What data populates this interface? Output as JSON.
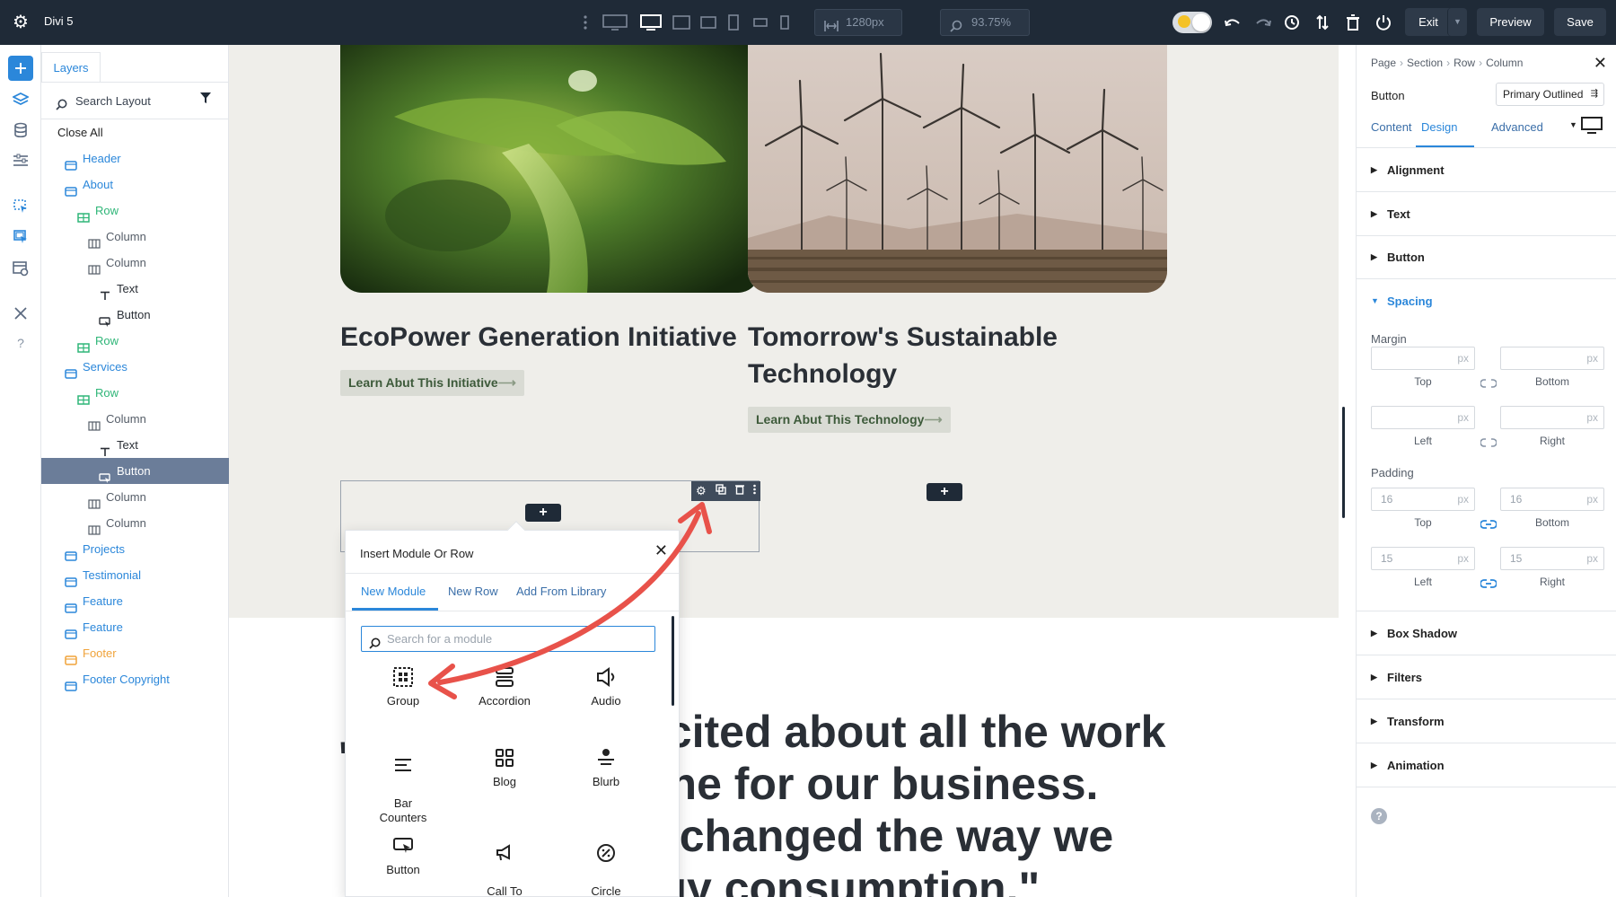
{
  "app": {
    "title": "Divi 5"
  },
  "toolbar": {
    "width_value": "1280px",
    "zoom_value": "93.75%",
    "exit_label": "Exit",
    "preview_label": "Preview",
    "save_label": "Save"
  },
  "layers": {
    "tab_label": "Layers",
    "search_placeholder": "Search Layout",
    "close_all": "Close All",
    "items": [
      {
        "label": "Header",
        "kind": "section"
      },
      {
        "label": "About",
        "kind": "section"
      },
      {
        "label": "Row",
        "kind": "row"
      },
      {
        "label": "Column",
        "kind": "column"
      },
      {
        "label": "Column",
        "kind": "column"
      },
      {
        "label": "Text",
        "kind": "text"
      },
      {
        "label": "Button",
        "kind": "button"
      },
      {
        "label": "Row",
        "kind": "row"
      },
      {
        "label": "Services",
        "kind": "section"
      },
      {
        "label": "Row",
        "kind": "row"
      },
      {
        "label": "Column",
        "kind": "column"
      },
      {
        "label": "Text",
        "kind": "text"
      },
      {
        "label": "Button",
        "kind": "button",
        "selected": true
      },
      {
        "label": "Column",
        "kind": "column"
      },
      {
        "label": "Column",
        "kind": "column"
      },
      {
        "label": "Projects",
        "kind": "section"
      },
      {
        "label": "Testimonial",
        "kind": "section"
      },
      {
        "label": "Feature",
        "kind": "section"
      },
      {
        "label": "Feature",
        "kind": "section"
      },
      {
        "label": "Footer",
        "kind": "footer"
      },
      {
        "label": "Footer Copyright",
        "kind": "section"
      }
    ]
  },
  "canvas": {
    "card1": {
      "title": "EcoPower Generation Initiative",
      "button": "Learn Abut This Initiative"
    },
    "card2": {
      "title_line1": "Tomorrow's Sustainable",
      "title_line2": "Technology",
      "button": "Learn Abut This Technology"
    },
    "quote_lines": [
      "xcited about all the work",
      "one for our business.",
      "y changed the way we",
      "rgy consumption.\""
    ]
  },
  "modal": {
    "title": "Insert Module Or Row",
    "tabs": [
      "New Module",
      "New Row",
      "Add From Library"
    ],
    "search_placeholder": "Search for a module",
    "modules": [
      {
        "label": "Group",
        "icon": "group-icon"
      },
      {
        "label": "Accordion",
        "icon": "accordion-icon"
      },
      {
        "label": "Audio",
        "icon": "audio-icon"
      },
      {
        "label": "Bar\nCounters",
        "icon": "bar-counters-icon"
      },
      {
        "label": "Blog",
        "icon": "blog-icon"
      },
      {
        "label": "Blurb",
        "icon": "blurb-icon"
      },
      {
        "label": "Button",
        "icon": "button-icon"
      },
      {
        "label": "Call To\nAction",
        "icon": "call-to-action-icon"
      },
      {
        "label": "Circle\nCounter",
        "icon": "circle-counter-icon"
      }
    ]
  },
  "settings": {
    "breadcrumb": [
      "Page",
      "Section",
      "Row",
      "Column"
    ],
    "module_name": "Button",
    "preset": "Primary Outlined",
    "tabs": [
      "Content",
      "Design",
      "Advanced"
    ],
    "active_tab": "Design",
    "groups_top": [
      "Alignment",
      "Text",
      "Button"
    ],
    "spacing_label": "Spacing",
    "margin_label": "Margin",
    "padding_label": "Padding",
    "unit": "px",
    "margin": {
      "top": "",
      "bottom": "",
      "left": "",
      "right": ""
    },
    "padding": {
      "top": "16",
      "bottom": "16",
      "left": "15",
      "right": "15"
    },
    "captions": {
      "top": "Top",
      "bottom": "Bottom",
      "left": "Left",
      "right": "Right"
    },
    "groups_bottom": [
      "Box Shadow",
      "Filters",
      "Transform",
      "Animation"
    ]
  },
  "colors": {
    "accent": "#2b87da",
    "topbar": "#1f2a37",
    "row_green": "#2fb678",
    "footer_orange": "#f0a33a",
    "arrow_red": "#e8524a"
  }
}
